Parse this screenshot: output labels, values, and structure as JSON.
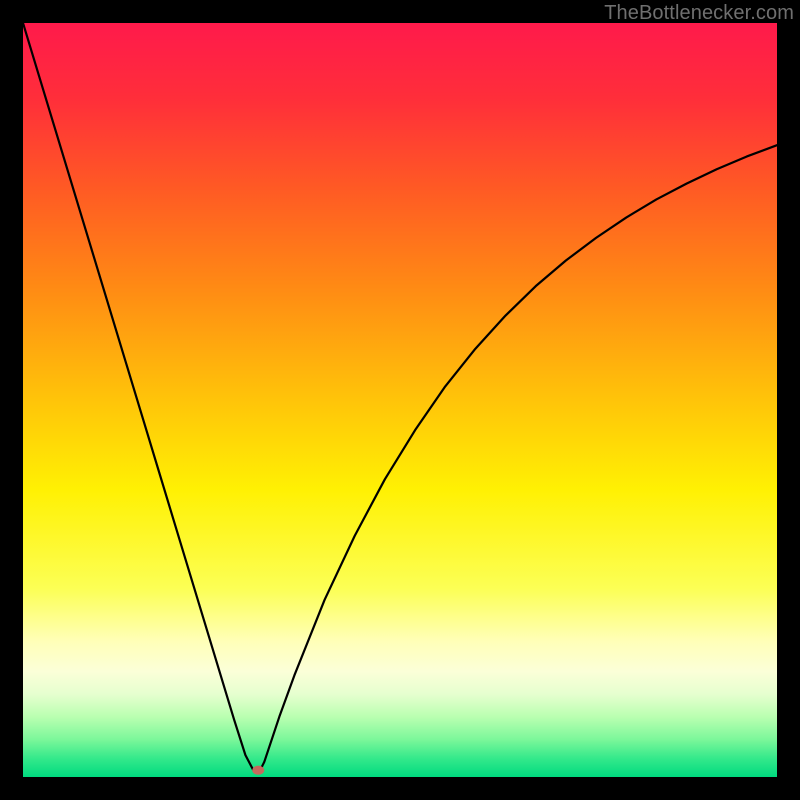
{
  "watermark": "TheBottlenecker.com",
  "chart_data": {
    "type": "line",
    "title": "",
    "xlabel": "",
    "ylabel": "",
    "xlim": [
      0,
      100
    ],
    "ylim": [
      0,
      100
    ],
    "grid": false,
    "series": [
      {
        "name": "bottleneck-curve",
        "x": [
          0,
          2,
          4,
          6,
          8,
          10,
          12,
          14,
          16,
          18,
          20,
          22,
          24,
          26,
          28,
          29.5,
          30.5,
          31.5,
          32,
          34,
          36,
          40,
          44,
          48,
          52,
          56,
          60,
          64,
          68,
          72,
          76,
          80,
          84,
          88,
          92,
          96,
          100
        ],
        "y": [
          100,
          93.4,
          86.8,
          80.2,
          73.6,
          67.0,
          60.4,
          53.8,
          47.2,
          40.6,
          34.0,
          27.4,
          20.8,
          14.2,
          7.6,
          2.9,
          1.0,
          1.0,
          2.0,
          8.0,
          13.5,
          23.5,
          32.0,
          39.5,
          46.0,
          51.8,
          56.8,
          61.2,
          65.1,
          68.5,
          71.5,
          74.2,
          76.6,
          78.7,
          80.6,
          82.3,
          83.8
        ]
      }
    ],
    "marker": {
      "x": 31.2,
      "y": 0.9,
      "color": "#c46a5d",
      "rx": 6,
      "ry": 4.6
    },
    "background_gradient": {
      "stops": [
        {
          "offset": 0.0,
          "color": "#ff1a4b"
        },
        {
          "offset": 0.1,
          "color": "#ff2e3a"
        },
        {
          "offset": 0.22,
          "color": "#ff5a24"
        },
        {
          "offset": 0.35,
          "color": "#ff8a14"
        },
        {
          "offset": 0.5,
          "color": "#ffc409"
        },
        {
          "offset": 0.62,
          "color": "#fff103"
        },
        {
          "offset": 0.75,
          "color": "#fcff55"
        },
        {
          "offset": 0.82,
          "color": "#ffffb8"
        },
        {
          "offset": 0.86,
          "color": "#fbffd8"
        },
        {
          "offset": 0.89,
          "color": "#e6ffcf"
        },
        {
          "offset": 0.92,
          "color": "#baffb1"
        },
        {
          "offset": 0.95,
          "color": "#7cf79a"
        },
        {
          "offset": 0.975,
          "color": "#35e98b"
        },
        {
          "offset": 1.0,
          "color": "#00da7f"
        }
      ]
    }
  }
}
